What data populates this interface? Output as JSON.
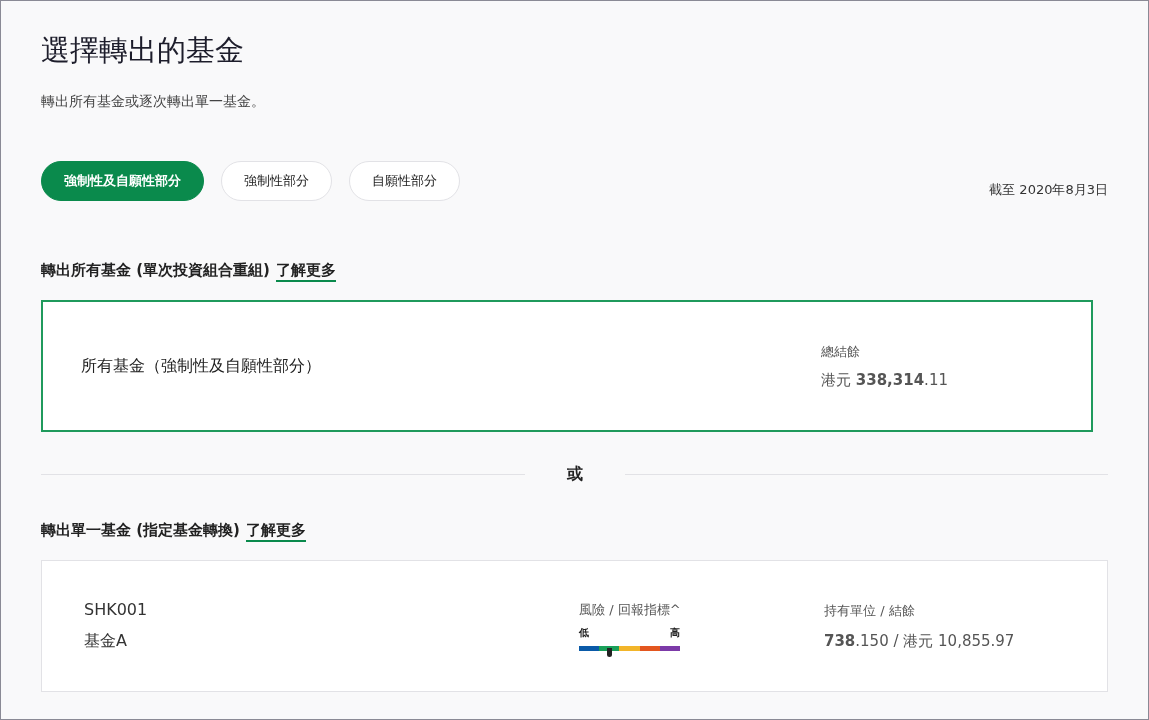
{
  "page": {
    "title": "選擇轉出的基金",
    "subtitle": "轉出所有基金或逐次轉出單一基金。",
    "as_of": "截至 2020年8月3日"
  },
  "tabs": [
    {
      "label": "強制性及自願性部分",
      "selected": true
    },
    {
      "label": "強制性部分",
      "selected": false
    },
    {
      "label": "自願性部分",
      "selected": false
    }
  ],
  "all_funds": {
    "heading": "轉出所有基金 (單次投資組合重組)",
    "link": "了解更多",
    "name": "所有基金（強制性及自願性部分）",
    "balance_label": "總結餘",
    "balance": "港元 **338,314**.11",
    "selected": true
  },
  "divider_text": "或",
  "single_fund": {
    "heading": "轉出單一基金 (指定基金轉換)",
    "link": "了解更多",
    "funds": [
      {
        "code": "SHK001",
        "name": "基金A",
        "risk_label": "風險 / 回報指標^",
        "risk_low": "低",
        "risk_high": "高",
        "level": 0.3,
        "holdings_label": "持有單位 / 結餘",
        "holdings": "**738**.150 /  港元 10,855.97",
        "selected": false
      }
    ]
  }
}
